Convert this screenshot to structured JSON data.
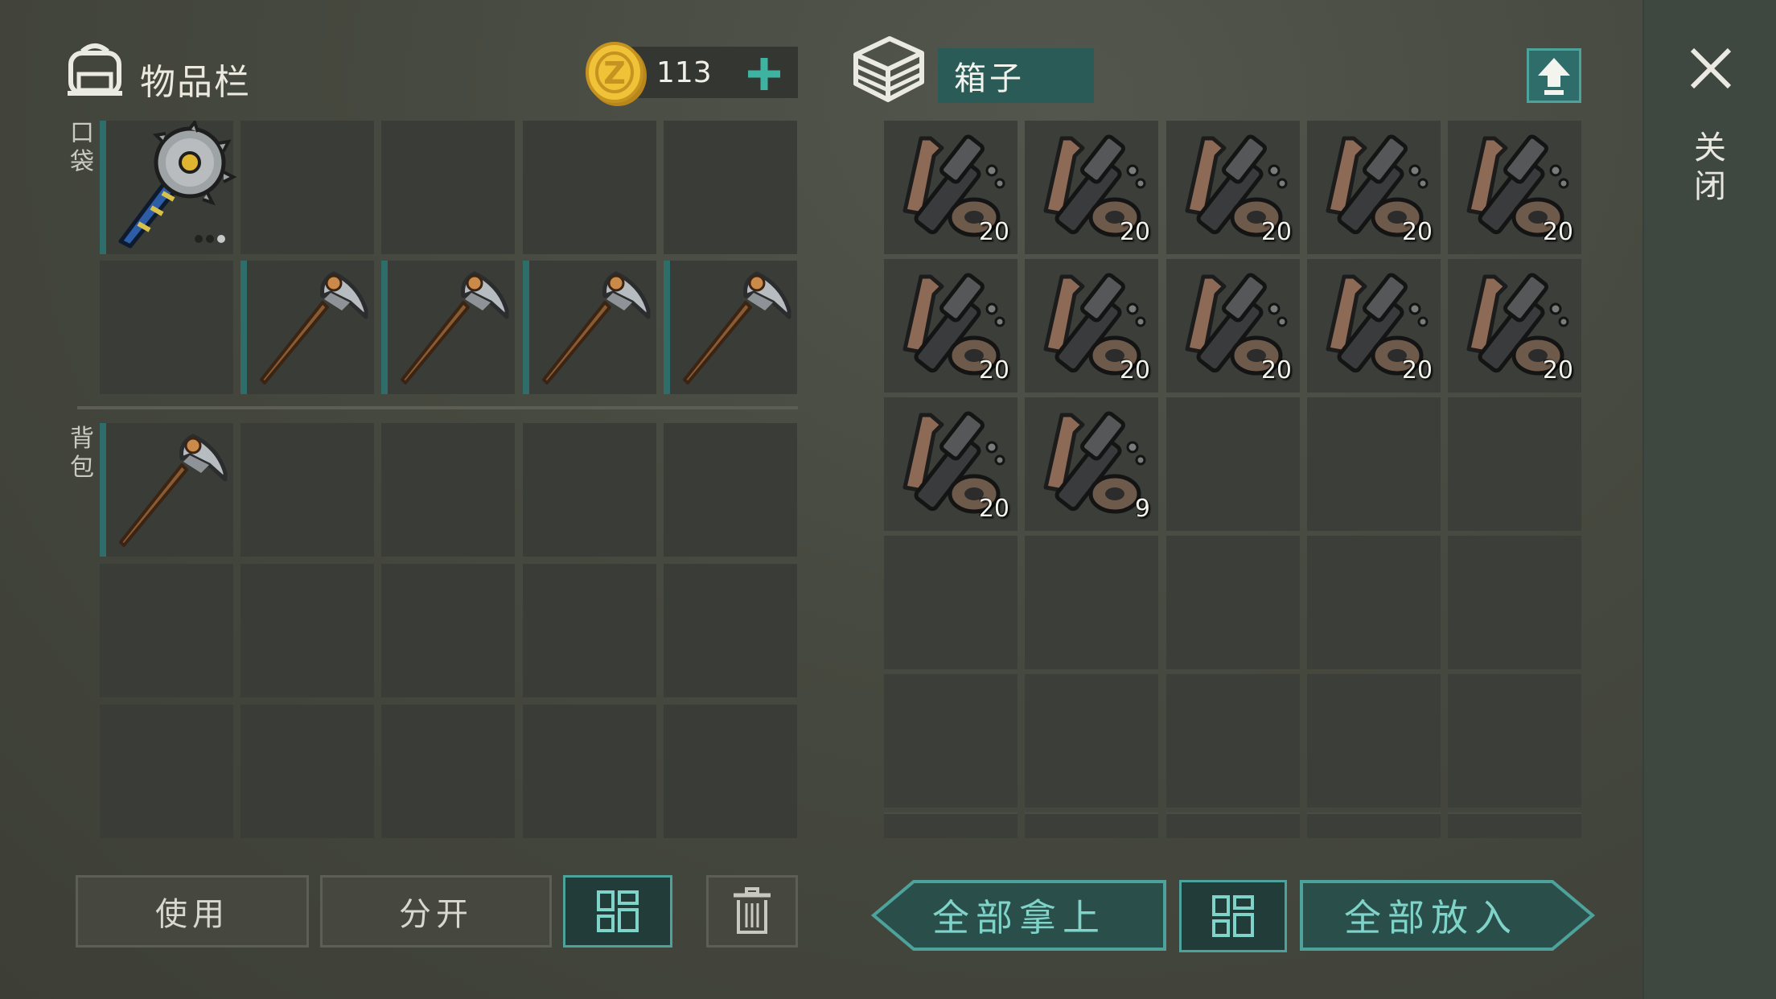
{
  "inventory": {
    "title": "物品栏",
    "coins": "113",
    "pocket_label": "口袋",
    "backpack_label": "背包",
    "buttons": {
      "use": "使用",
      "split": "分开"
    }
  },
  "chest": {
    "title": "箱子",
    "take_all": "全部拿上",
    "put_all": "全部放入",
    "close_label": "关闭",
    "stacks": [
      "20",
      "20",
      "20",
      "20",
      "20",
      "20",
      "20",
      "20",
      "20",
      "20",
      "20",
      "9"
    ]
  },
  "colors": {
    "accent": "#4da39b",
    "teal_dark": "#2b5b57",
    "marker": "#2f6d6a"
  },
  "icons": {
    "backpack": "backpack-icon",
    "coin": "coin-icon",
    "add": "plus-icon",
    "chest": "chest-icon",
    "upload": "upload-arrow-icon",
    "close": "close-icon",
    "sort": "sort-grid-icon",
    "trash": "trash-icon",
    "items": [
      "saw-hammer-icon",
      "pickaxe-icon",
      "crossbow-parts-icon"
    ]
  }
}
